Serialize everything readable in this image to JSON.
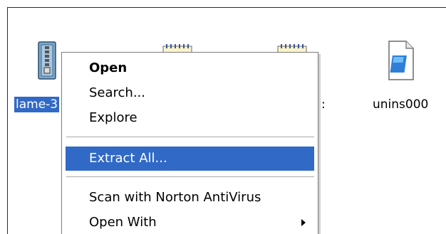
{
  "desktop": {
    "files": [
      {
        "label": "lame-3",
        "icon": "archive-folder-icon",
        "selected": true
      },
      {
        "label": "",
        "icon": "notepad-document-icon",
        "selected": false
      },
      {
        "label": "",
        "icon": "notepad-document-icon",
        "selected": false
      },
      {
        "label": "unins000",
        "icon": "uninstall-data-file-icon",
        "selected": false
      }
    ],
    "hidden_fragment": ":"
  },
  "context_menu": {
    "items": [
      {
        "label": "Open",
        "bold": true
      },
      {
        "label": "Search..."
      },
      {
        "label": "Explore"
      },
      {
        "label": "Extract All...",
        "highlighted": true
      },
      {
        "label": "Scan with Norton AntiVirus"
      },
      {
        "label": "Open With",
        "has_submenu": true
      }
    ]
  },
  "colors": {
    "selection": "#3169c6",
    "menu_border": "#7a7a7a"
  }
}
